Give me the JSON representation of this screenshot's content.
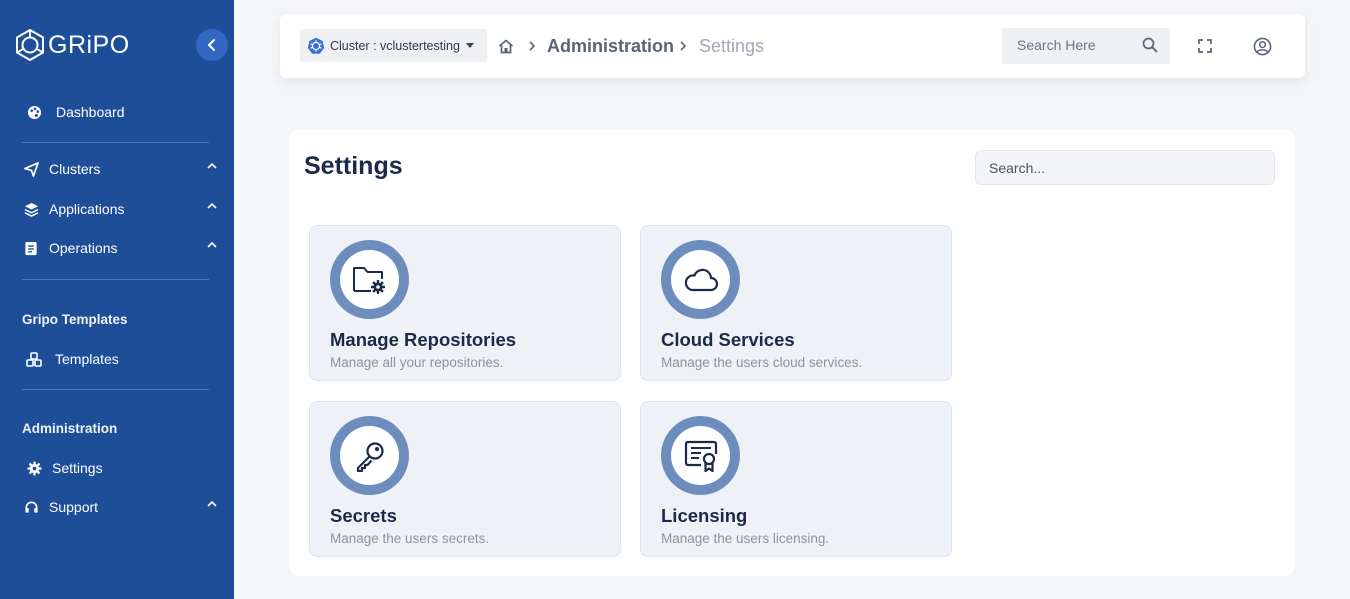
{
  "brand": {
    "name": "GRiPO"
  },
  "sidebar": {
    "items": [
      {
        "label": "Dashboard",
        "icon": "palette-icon"
      },
      {
        "label": "Clusters",
        "icon": "send-icon",
        "expandable": true
      },
      {
        "label": "Applications",
        "icon": "layers-icon",
        "expandable": true
      },
      {
        "label": "Operations",
        "icon": "document-icon",
        "expandable": true
      }
    ],
    "sections": [
      {
        "heading": "Gripo Templates",
        "items": [
          {
            "label": "Templates",
            "icon": "cubes-icon"
          }
        ]
      },
      {
        "heading": "Administration",
        "items": [
          {
            "label": "Settings",
            "icon": "gear-icon",
            "active": true
          },
          {
            "label": "Support",
            "icon": "headset-icon",
            "expandable": true
          }
        ]
      }
    ]
  },
  "topbar": {
    "cluster_label": "Cluster : vclustertesting",
    "breadcrumb": [
      "Administration",
      "Settings"
    ],
    "search_placeholder": "Search Here"
  },
  "main": {
    "title": "Settings",
    "search_placeholder": "Search...",
    "cards": [
      {
        "title": "Manage Repositories",
        "description": "Manage all your repositories.",
        "icon": "folder-gear-icon"
      },
      {
        "title": "Cloud Services",
        "description": "Manage the users cloud services.",
        "icon": "cloud-icon"
      },
      {
        "title": "Secrets",
        "description": "Manage the users secrets.",
        "icon": "key-icon"
      },
      {
        "title": "Licensing",
        "description": "Manage the users licensing.",
        "icon": "certificate-icon"
      }
    ]
  },
  "colors": {
    "sidebar": "#1f4e99",
    "accent": "#3467c4",
    "icon_ring": "#6d8ebd",
    "card_bg": "#eef1f6"
  }
}
